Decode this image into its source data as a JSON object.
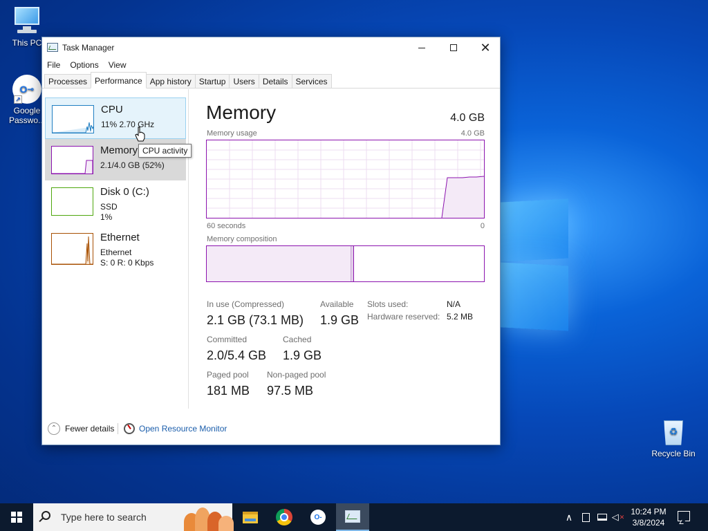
{
  "desktop": {
    "icons": {
      "this_pc": "This PC",
      "google_passwords": "Google Passwo...",
      "google_passwords_line1": "Google",
      "google_passwords_line2": "Passwo...",
      "recycle_bin": "Recycle Bin"
    }
  },
  "window": {
    "title": "Task Manager",
    "controls": {
      "minimize": "minimize-icon",
      "maximize": "maximize-icon",
      "close": "✕"
    }
  },
  "menu": {
    "file": "File",
    "options": "Options",
    "view": "View"
  },
  "tabs": [
    {
      "label": "Processes"
    },
    {
      "label": "Performance"
    },
    {
      "label": "App history"
    },
    {
      "label": "Startup"
    },
    {
      "label": "Users"
    },
    {
      "label": "Details"
    },
    {
      "label": "Services"
    }
  ],
  "sidebar": {
    "cpu": {
      "label": "CPU",
      "sub": "11%  2.70 GHz",
      "color": "#1f7ec2"
    },
    "memory": {
      "label": "Memory",
      "sub": "2.1/4.0 GB (52%)",
      "color": "#8b12ae"
    },
    "disk": {
      "label": "Disk 0 (C:)",
      "sub1": "SSD",
      "sub2": "1%",
      "color": "#4da60c"
    },
    "ethernet": {
      "label": "Ethernet",
      "sub1": "Ethernet",
      "sub2": "S: 0  R: 0 Kbps",
      "color": "#a74f01"
    }
  },
  "tooltip": "CPU activity",
  "main": {
    "heading": "Memory",
    "total": "4.0 GB",
    "usage_label": "Memory usage",
    "usage_max": "4.0 GB",
    "time_left": "60 seconds",
    "time_right": "0",
    "composition_label": "Memory composition",
    "usage_fraction": 0.52,
    "stats": {
      "in_use_label": "In use (Compressed)",
      "in_use_value": "2.1 GB (73.1 MB)",
      "available_label": "Available",
      "available_value": "1.9 GB",
      "committed_label": "Committed",
      "committed_value": "2.0/5.4 GB",
      "cached_label": "Cached",
      "cached_value": "1.9 GB",
      "paged_label": "Paged pool",
      "paged_value": "181 MB",
      "nonpaged_label": "Non-paged pool",
      "nonpaged_value": "97.5 MB",
      "slots_label": "Slots used:",
      "slots_value": "N/A",
      "hw_label": "Hardware reserved:",
      "hw_value": "5.2 MB"
    }
  },
  "footer": {
    "fewer_details": "Fewer details",
    "open_resource_monitor": "Open Resource Monitor"
  },
  "taskbar": {
    "search_placeholder": "Type here to search",
    "apps": [
      "file-explorer-icon",
      "chrome-icon",
      "google-passwords-icon",
      "task-manager-icon"
    ],
    "time": "10:24 PM",
    "date": "3/8/2024"
  }
}
